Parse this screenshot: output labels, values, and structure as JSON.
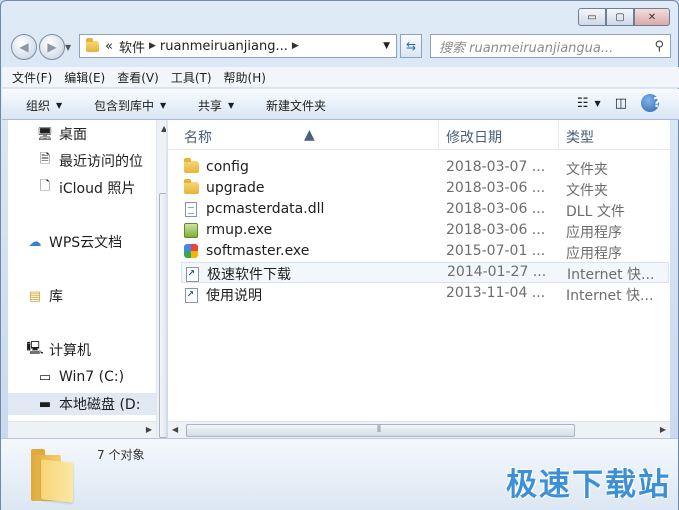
{
  "window": {
    "caption_buttons": {
      "minimize": "▭",
      "maximize": "▢",
      "close": "✕"
    }
  },
  "address": {
    "prefix": "«",
    "segments": [
      "软件",
      "ruanmeiruanjiang..."
    ],
    "search_placeholder": "搜索 ruanmeiruanjiangua..."
  },
  "menubar": [
    "文件(F)",
    "编辑(E)",
    "查看(V)",
    "工具(T)",
    "帮助(H)"
  ],
  "commands": {
    "organize": "组织",
    "include_library": "包含到库中",
    "share": "共享",
    "new_folder": "新建文件夹"
  },
  "nav": {
    "items": [
      {
        "label": "桌面",
        "icon": "desktop-icon"
      },
      {
        "label": "最近访问的位",
        "icon": "recent-places-icon"
      },
      {
        "label": "iCloud 照片",
        "icon": "document-icon"
      },
      {
        "label": "WPS云文档",
        "icon": "cloud-icon"
      },
      {
        "label": "库",
        "icon": "library-icon"
      },
      {
        "label": "计算机",
        "icon": "computer-icon"
      },
      {
        "label": "Win7 (C:)",
        "icon": "drive-c-icon"
      },
      {
        "label": "本地磁盘 (D:",
        "icon": "drive-icon"
      }
    ]
  },
  "columns": {
    "name": "名称",
    "date": "修改日期",
    "type": "类型"
  },
  "files": [
    {
      "name": "config",
      "date": "2018-03-07 ...",
      "type": "文件夹",
      "icon": "folder-icon"
    },
    {
      "name": "upgrade",
      "date": "2018-03-06 ...",
      "type": "文件夹",
      "icon": "folder-icon"
    },
    {
      "name": "pcmasterdata.dll",
      "date": "2018-03-06 ...",
      "type": "DLL 文件",
      "icon": "dll-file-icon"
    },
    {
      "name": "rmup.exe",
      "date": "2018-03-06 ...",
      "type": "应用程序",
      "icon": "exe-icon"
    },
    {
      "name": "softmaster.exe",
      "date": "2015-07-01 ...",
      "type": "应用程序",
      "icon": "exe-icon"
    },
    {
      "name": "极速软件下载",
      "date": "2014-01-27 ...",
      "type": "Internet 快...",
      "icon": "shortcut-icon"
    },
    {
      "name": "使用说明",
      "date": "2013-11-04 ...",
      "type": "Internet 快...",
      "icon": "shortcut-icon"
    }
  ],
  "status": {
    "count": "7 个对象"
  },
  "watermark": "极速下载站"
}
